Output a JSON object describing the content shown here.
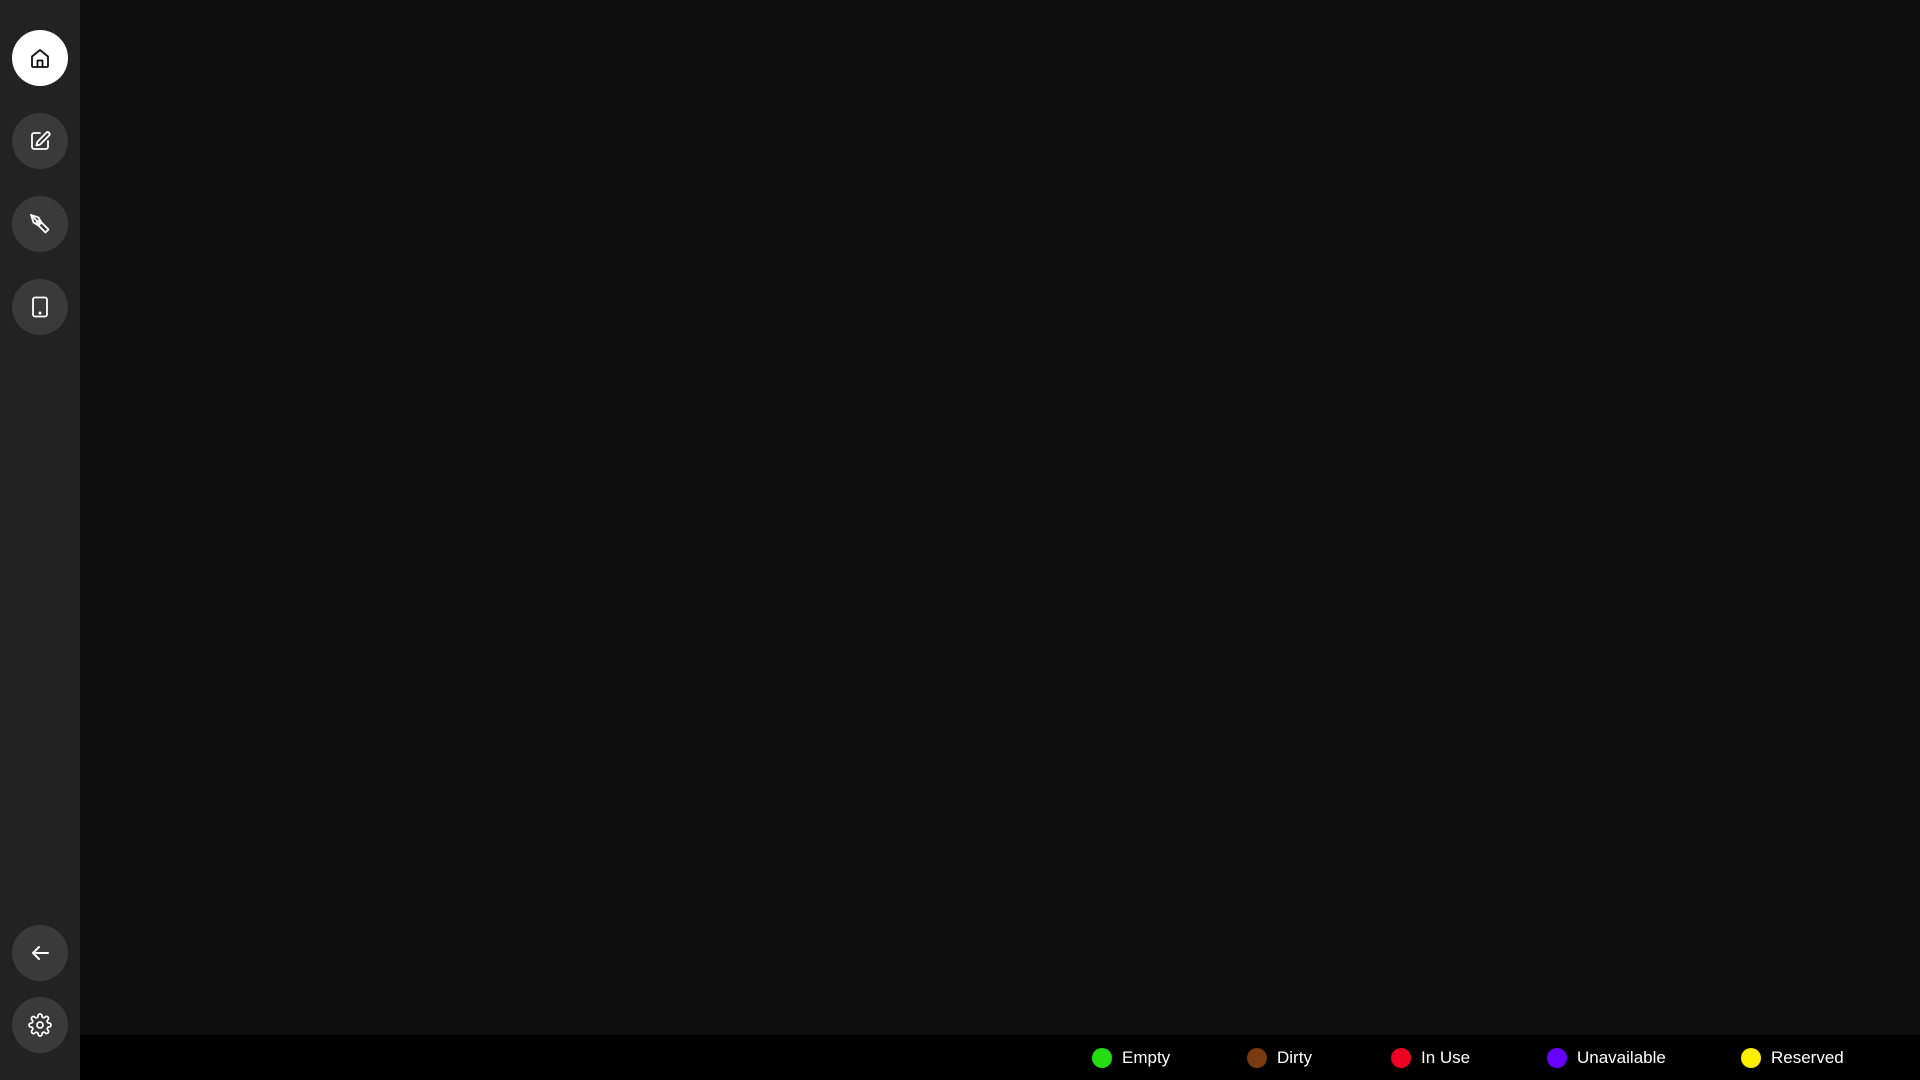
{
  "sidebar": {
    "top_items": [
      {
        "icon": "home-icon",
        "active": true
      },
      {
        "icon": "edit-icon",
        "active": false
      },
      {
        "icon": "pen-tool-icon",
        "active": false
      },
      {
        "icon": "tablet-icon",
        "active": false
      }
    ],
    "bottom_items": [
      {
        "icon": "arrow-left-icon"
      },
      {
        "icon": "gear-icon"
      }
    ]
  },
  "legend": {
    "items": [
      {
        "label": "Empty",
        "color": "#22dd11"
      },
      {
        "label": "Dirty",
        "color": "#7a3a10"
      },
      {
        "label": "In Use",
        "color": "#ee0022"
      },
      {
        "label": "Unavailable",
        "color": "#6600ff"
      },
      {
        "label": "Reserved",
        "color": "#ffee00"
      }
    ]
  },
  "colors": {
    "sidebar_bg": "#222222",
    "main_bg": "#0e0e0e",
    "legend_bg": "#000000",
    "button_bg": "#3a3a3a",
    "active_button_bg": "#ffffff"
  }
}
